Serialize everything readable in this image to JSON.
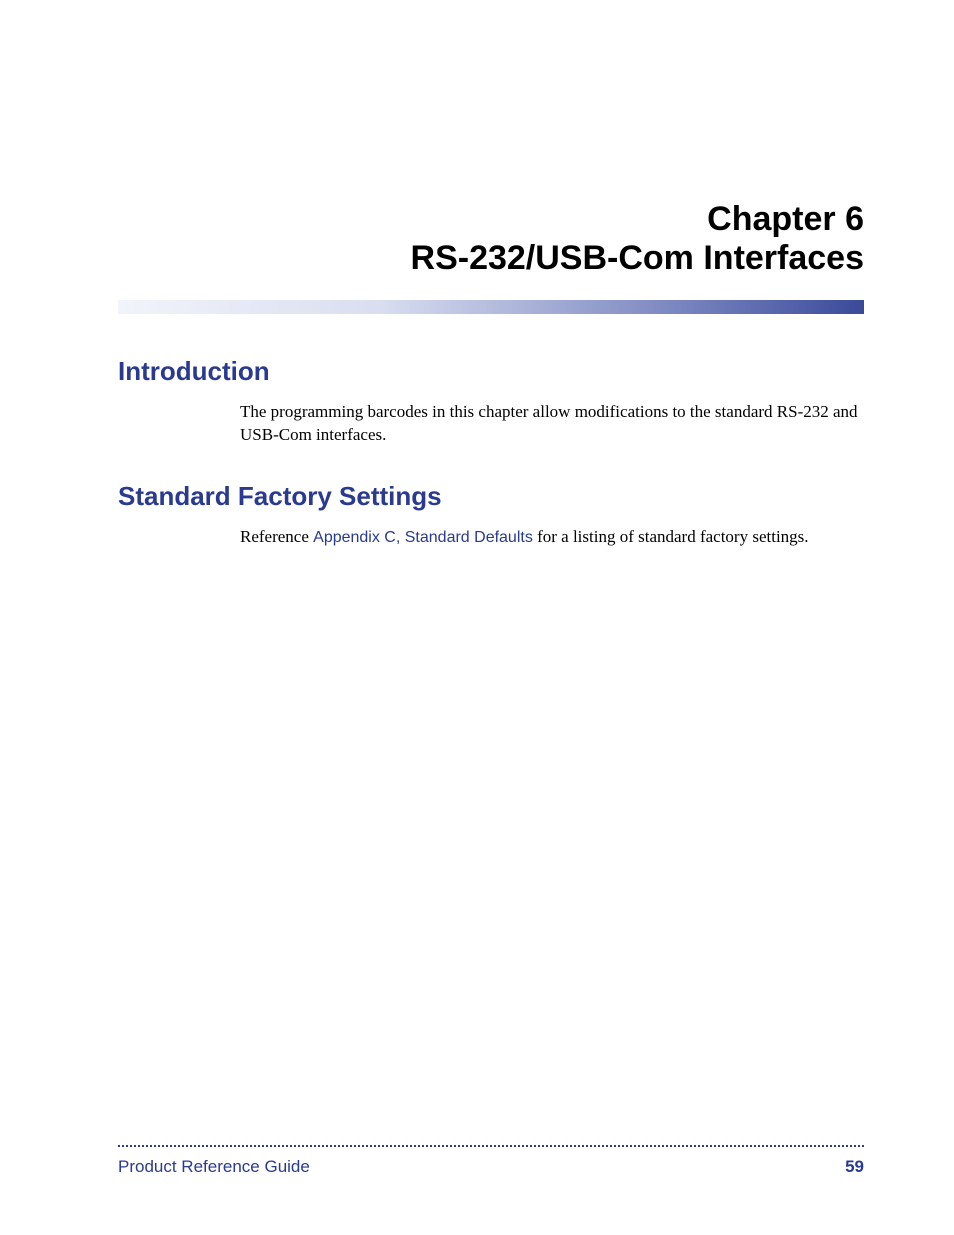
{
  "chapter": {
    "label": "Chapter 6",
    "title": "RS-232/USB-Com Interfaces"
  },
  "sections": [
    {
      "heading": "Introduction",
      "body_plain": "The programming barcodes in this chapter allow modifications to the standard RS-232 and USB-Com interfaces."
    },
    {
      "heading": "Standard Factory Settings",
      "body_prefix": "Reference ",
      "xref": "Appendix C, Standard Defaults",
      "body_suffix": " for a listing of standard factory settings."
    }
  ],
  "footer": {
    "doc_title": "Product Reference Guide",
    "page_number": "59"
  }
}
